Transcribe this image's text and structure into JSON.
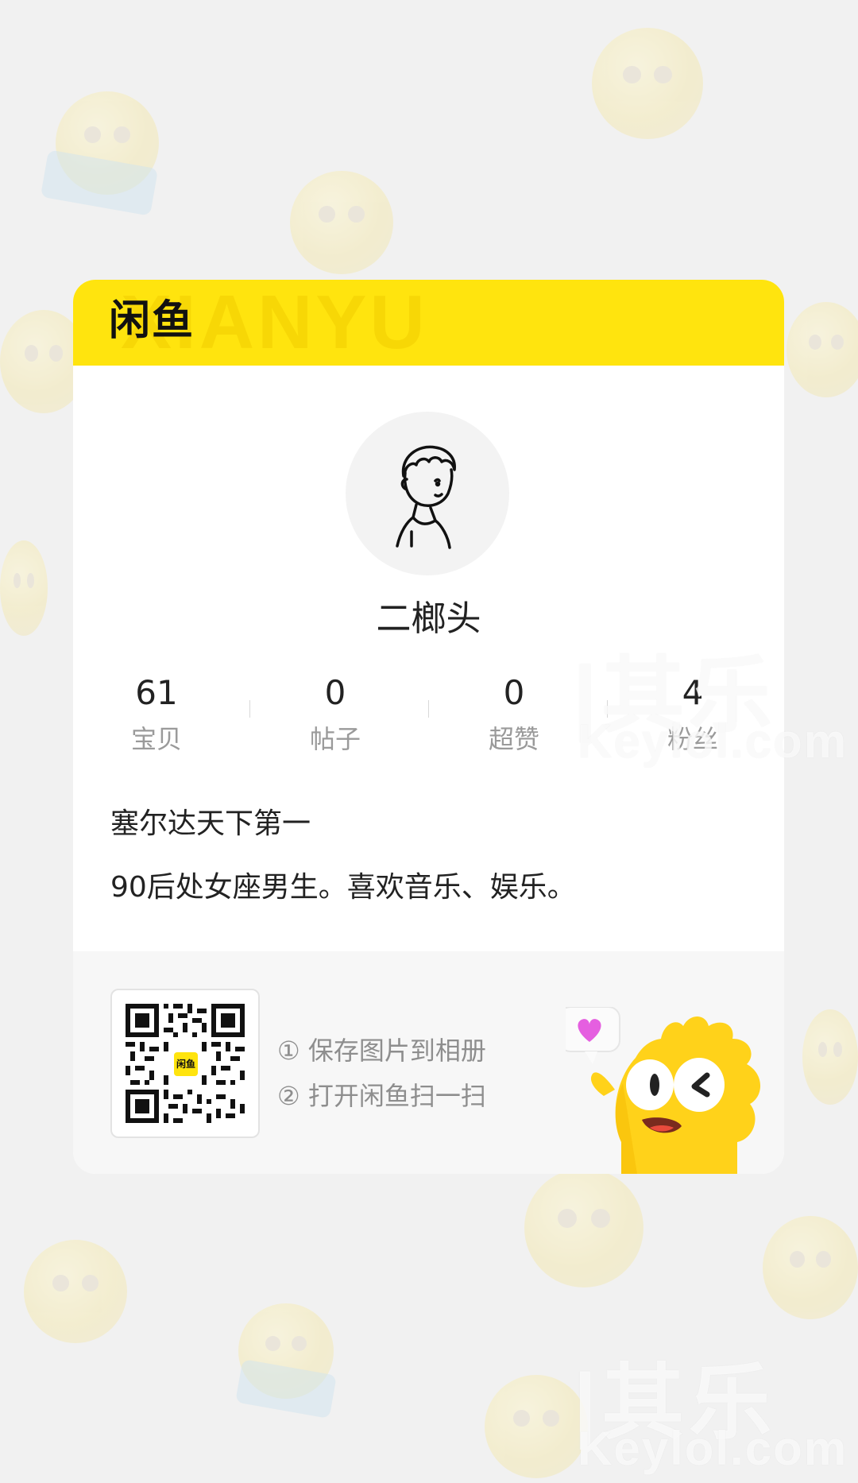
{
  "brand": {
    "logo_text": "闲鱼",
    "header_bg_text": "XIANYU",
    "accent_color": "#ffe40e"
  },
  "profile": {
    "avatar_icon": "sketch-boy-avatar",
    "nickname": "二榔头",
    "stats": [
      {
        "value": "61",
        "label": "宝贝"
      },
      {
        "value": "0",
        "label": "帖子"
      },
      {
        "value": "0",
        "label": "超赞"
      },
      {
        "value": "4",
        "label": "粉丝"
      }
    ],
    "bio_title": "塞尔达天下第一",
    "bio_desc": "90后处女座男生。喜欢音乐、娱乐。"
  },
  "share": {
    "qr_icon": "qr-code",
    "qr_logo": "闲鱼",
    "steps": [
      "① 保存图片到相册",
      "② 打开闲鱼扫一扫"
    ],
    "mascot_icon": "yellow-fish-mascot-with-heart-bubble"
  },
  "watermark": {
    "cn": "|其乐",
    "en": "Keylol.com"
  }
}
